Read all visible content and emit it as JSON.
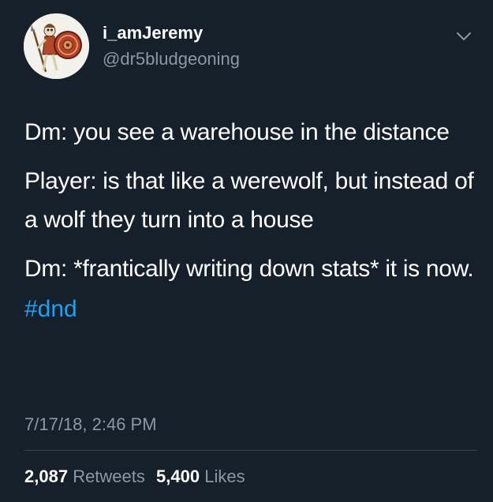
{
  "user": {
    "display_name": "i_amJeremy",
    "handle": "@dr5bludgeoning",
    "avatar_icon": "skeleton-warrior-avatar"
  },
  "tweet": {
    "paragraphs": [
      "Dm: you see a warehouse in the distance",
      "Player: is that like a werewolf, but instead of a wolf they turn into a house",
      "Dm: *frantically writing down stats* it is now."
    ],
    "hashtag": "#dnd",
    "timestamp": "7/17/18, 2:46 PM"
  },
  "stats": {
    "retweets_count": "2,087",
    "retweets_label": "Retweets",
    "likes_count": "5,400",
    "likes_label": "Likes"
  },
  "colors": {
    "background": "#15202b",
    "text": "#ffffff",
    "secondary_text": "#8899a6",
    "link": "#1da1f2",
    "divider": "#38444d"
  }
}
